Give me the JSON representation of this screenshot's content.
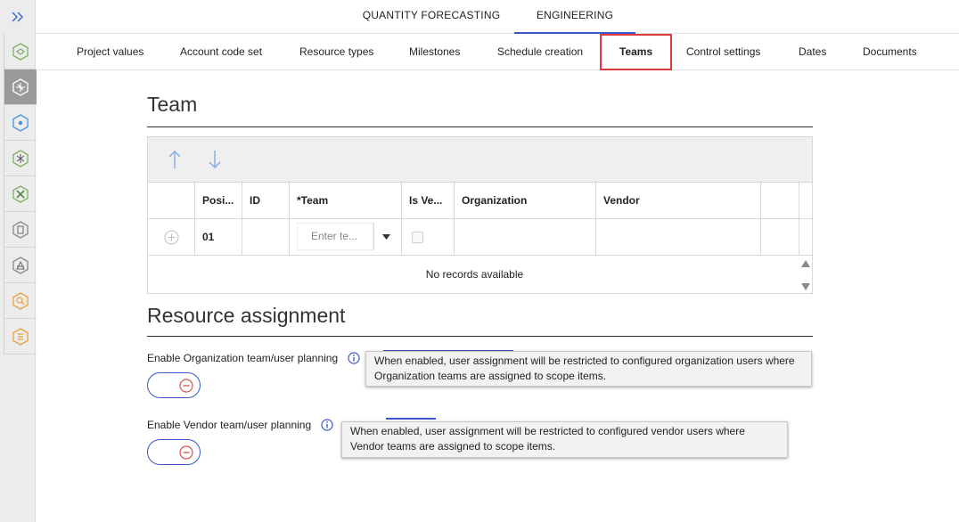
{
  "top_tabs": [
    "QUANTITY FORECASTING",
    "ENGINEERING"
  ],
  "sub_tabs": [
    "Project values",
    "Account code set",
    "Resource types",
    "Milestones",
    "Schedule creation",
    "Teams",
    "Control settings",
    "Dates",
    "Documents"
  ],
  "selected_sub_tab": "Teams",
  "team_section": {
    "title": "Team",
    "columns": [
      "Posi...",
      "ID",
      "*Team",
      "Is Ve...",
      "Organization",
      "Vendor"
    ],
    "new_row": {
      "position": "01",
      "team_placeholder": "Enter te..."
    },
    "empty_message": "No records available"
  },
  "resource_section": {
    "title": "Resource assignment",
    "org_label": "Enable Organization team/user planning",
    "org_tooltip_line1": "When enabled, user assignment will be restricted to configured organization users where",
    "org_tooltip_line2": "Organization teams are assigned to scope items.",
    "vendor_label": "Enable Vendor team/user planning",
    "vendor_tooltip_line1": "When enabled, user assignment will be restricted to configured vendor users where",
    "vendor_tooltip_line2": "Vendor teams are assigned to scope items."
  },
  "rail_icons": [
    "expand-icon",
    "project-icon",
    "schedule-icon",
    "hub-icon",
    "network-icon",
    "tools-icon",
    "document-icon",
    "measure-icon",
    "search-icon",
    "list-icon"
  ],
  "colors": {
    "accent": "#3b58c8",
    "highlight": "#e0393e",
    "rail_green": "#7fae63",
    "rail_blue": "#4a90d9",
    "rail_orange": "#e8a23c"
  }
}
